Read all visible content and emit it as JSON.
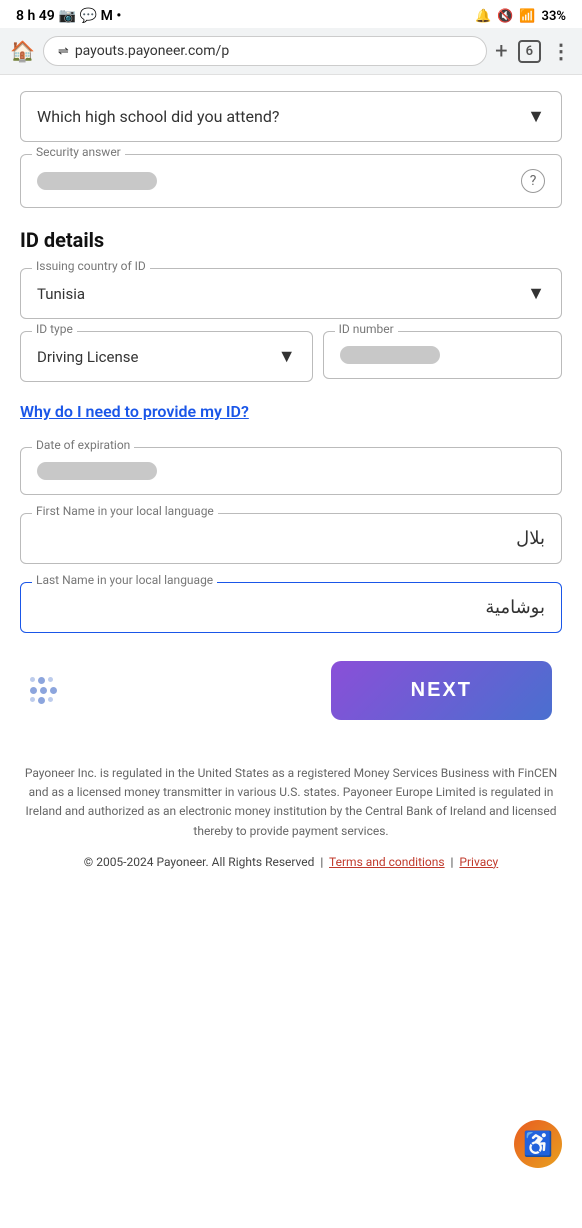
{
  "statusBar": {
    "time": "8 h 49",
    "icons": "📷 💬 M •",
    "rightIcons": "🔔 🔇 📶 33%"
  },
  "browserBar": {
    "url": "payouts.payoneer.com/p",
    "tabCount": "6"
  },
  "form": {
    "securityQuestion": {
      "label": "Which high school did you attend?",
      "answerLabel": "Security answer",
      "helpIcon": "?"
    },
    "idDetails": {
      "heading": "ID details",
      "issuingCountryLabel": "Issuing country of ID",
      "issuingCountryValue": "Tunisia",
      "idTypeLabel": "ID type",
      "idTypeValue": "Driving License",
      "idNumberLabel": "ID number",
      "idNumberPlaceholder": "",
      "whyLink": "Why do I need to provide my ID?",
      "dateOfExpirationLabel": "Date of expiration",
      "firstNameLabel": "First Name in your local language",
      "firstNameValue": "بلال",
      "lastNameLabel": "Last Name in your local language",
      "lastNameValue": "بوشامية"
    },
    "nextButton": "NEXT"
  },
  "footer": {
    "disclaimer": "Payoneer Inc. is regulated in the United States as a registered Money Services Business with FinCEN and as a licensed money transmitter in various U.S. states. Payoneer Europe Limited is regulated in Ireland and authorized as an electronic money institution by the Central Bank of Ireland and licensed thereby to provide payment services.",
    "copyright": "© 2005-2024 Payoneer. All Rights Reserved",
    "termsLink": "Terms and conditions",
    "privacyLink": "Privacy"
  }
}
